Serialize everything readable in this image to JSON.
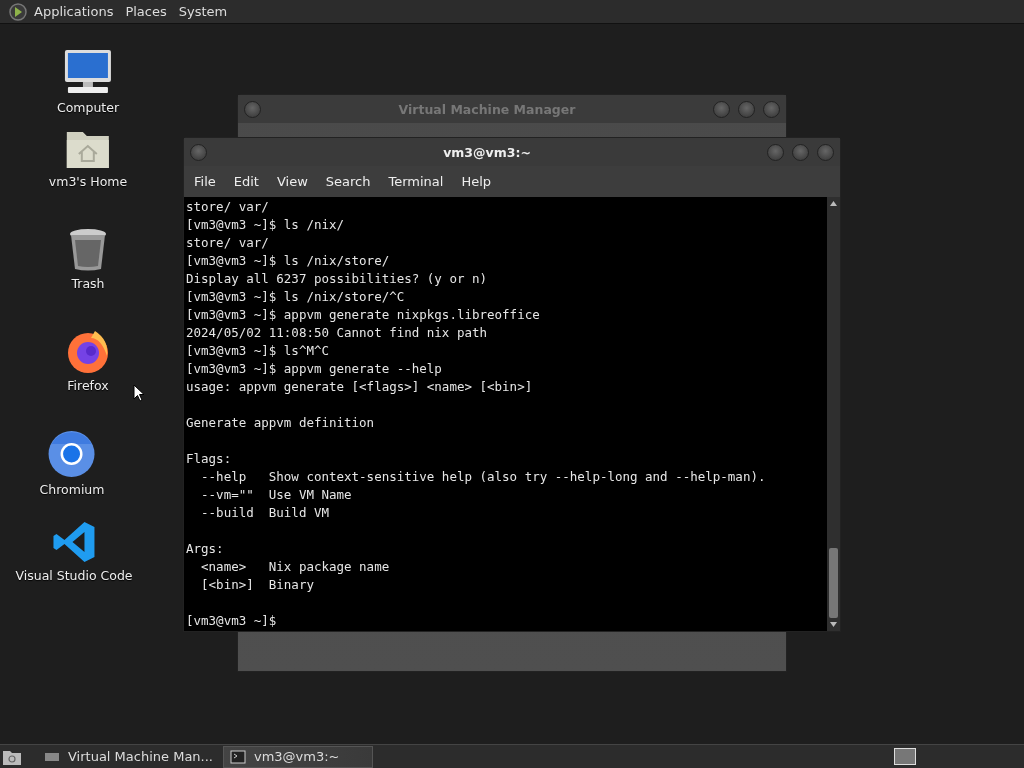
{
  "top_panel": {
    "menus": [
      "Applications",
      "Places",
      "System"
    ]
  },
  "desktop_icons": [
    {
      "kind": "computer",
      "label": "Computer"
    },
    {
      "kind": "home",
      "label": "vm3's Home"
    },
    {
      "kind": "trash",
      "label": "Trash"
    },
    {
      "kind": "firefox",
      "label": "Firefox"
    },
    {
      "kind": "chromium",
      "label": "Chromium"
    },
    {
      "kind": "vscode",
      "label": "Visual Studio Code"
    }
  ],
  "background_window": {
    "title": "Virtual Machine Manager"
  },
  "terminal": {
    "title": "vm3@vm3:~",
    "menu": [
      "File",
      "Edit",
      "View",
      "Search",
      "Terminal",
      "Help"
    ],
    "lines": [
      {
        "text": "store/ var/"
      },
      {
        "text": "[vm3@vm3 ~]$ ls /nix/"
      },
      {
        "text": "store/ var/"
      },
      {
        "text": "[vm3@vm3 ~]$ ls /nix/store/"
      },
      {
        "text": "Display all 6237 possibilities? (y or n)"
      },
      {
        "text": "[vm3@vm3 ~]$ ls /nix/store/^C"
      },
      {
        "text": "[vm3@vm3 ~]$ appvm generate nixpkgs.libreoffice"
      },
      {
        "text": "2024/05/02 11:08:50 Cannot find nix path"
      },
      {
        "text": "[vm3@vm3 ~]$ ls^M^C"
      },
      {
        "text": "[vm3@vm3 ~]$ appvm generate --help"
      },
      {
        "text": "usage: appvm generate [<flags>] <name> [<bin>]"
      },
      {
        "text": "Generate appvm definition",
        "blank_before": true
      },
      {
        "text": "Flags:",
        "blank_before": true
      },
      {
        "text": "  --help   Show context-sensitive help (also try --help-long and --help-man)."
      },
      {
        "text": "  --vm=\"\"  Use VM Name"
      },
      {
        "text": "  --build  Build VM"
      },
      {
        "text": "Args:",
        "blank_before": true
      },
      {
        "text": "  <name>   Nix package name"
      },
      {
        "text": "  [<bin>]  Binary"
      },
      {
        "text": "[vm3@vm3 ~]$",
        "blank_before": true
      }
    ]
  },
  "taskbar": {
    "tasks": [
      {
        "kind": "vm",
        "label": "Virtual Machine Man...",
        "selected": false
      },
      {
        "kind": "terminal",
        "label": "vm3@vm3:~",
        "selected": true
      }
    ]
  }
}
